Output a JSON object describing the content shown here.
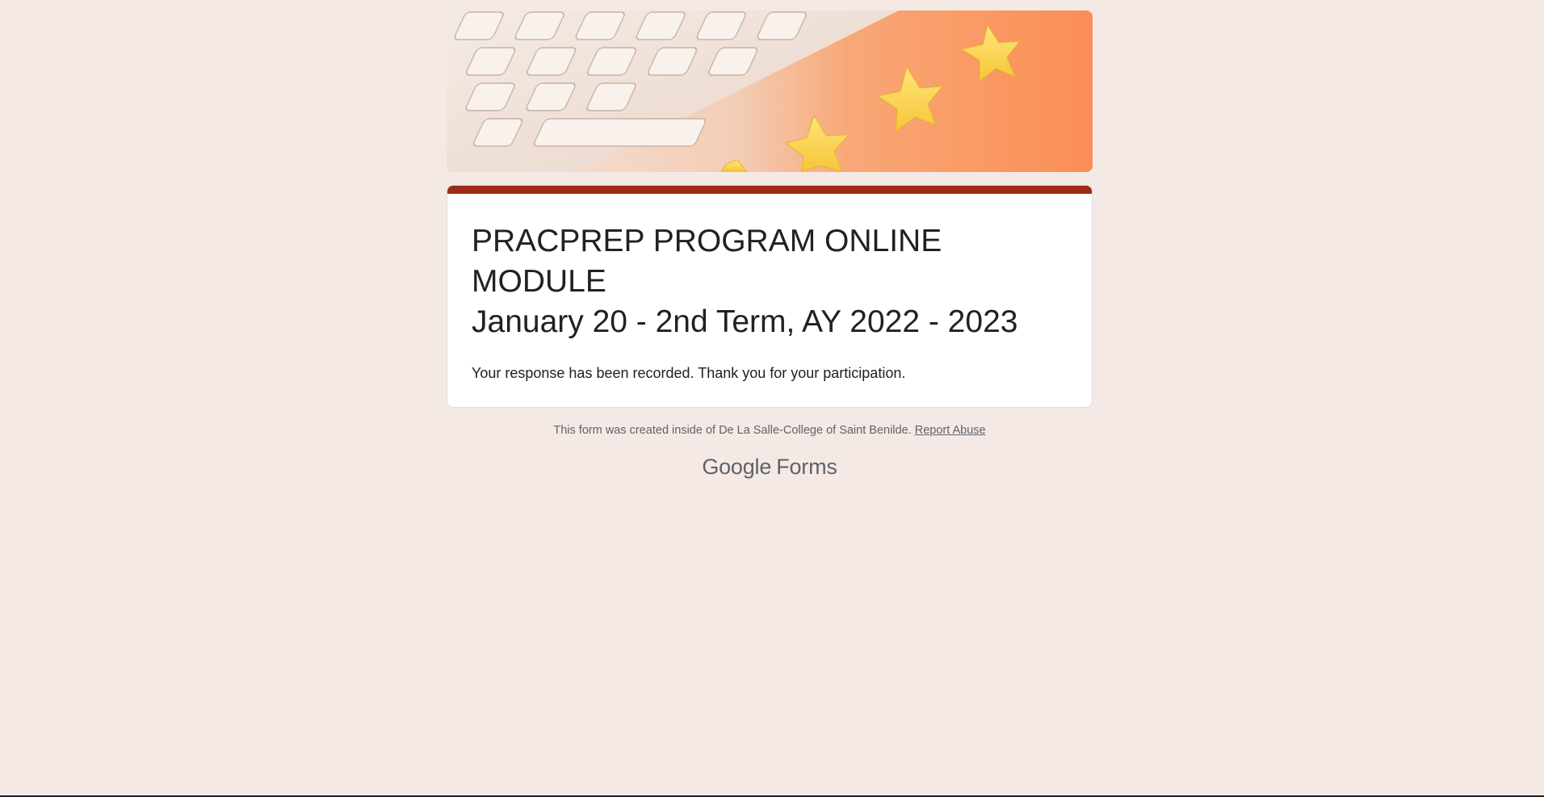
{
  "header": {
    "image_alt": "Keyboard with yellow stars on orange background"
  },
  "form": {
    "title_line1": "PRACPREP PROGRAM ONLINE MODULE",
    "title_line2": "January 20 - 2nd Term, AY 2022 - 2023",
    "confirmation_message": "Your response has been recorded. Thank you for your participation."
  },
  "footer": {
    "note": "This form was created inside of De La Salle-College of Saint Benilde.",
    "report_abuse": "Report Abuse"
  },
  "brand": {
    "google": "Google",
    "product": "Forms"
  },
  "colors": {
    "background": "#f5e9e6",
    "accent": "#9c2a14",
    "card": "#ffffff",
    "text": "#202124",
    "muted": "#5f6368"
  }
}
